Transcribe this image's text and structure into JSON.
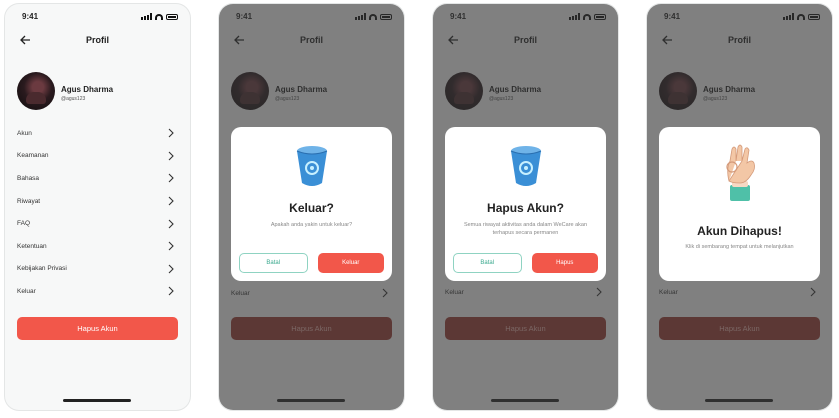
{
  "status": {
    "time": "9:41"
  },
  "header": {
    "title": "Profil"
  },
  "profile": {
    "name": "Agus Dharma",
    "username": "@agus123"
  },
  "menu": [
    {
      "label": "Akun"
    },
    {
      "label": "Keamanan"
    },
    {
      "label": "Bahasa"
    },
    {
      "label": "Riwayat"
    },
    {
      "label": "FAQ"
    },
    {
      "label": "Ketentuan"
    },
    {
      "label": "Kebijakan Privasi"
    },
    {
      "label": "Keluar"
    }
  ],
  "delete_button": "Hapus Akun",
  "logout_modal": {
    "title": "Keluar?",
    "text": "Apakah anda yakin untuk keluar?",
    "cancel": "Batal",
    "confirm": "Keluar"
  },
  "delete_modal": {
    "title": "Hapus Akun?",
    "text": "Semua riwayat aktivitas anda dalam WeCare akan terhapus secara permanen",
    "cancel": "Batal",
    "confirm": "Hapus"
  },
  "deleted_modal": {
    "title": "Akun Dihapus!",
    "text": "Klik di sembarang tempat untuk melanjutkan"
  },
  "colors": {
    "accent": "#f2574a",
    "teal": "#3aa98e",
    "overlay": "#373737"
  },
  "icons": {
    "back": "arrow-left-icon",
    "chevron": "chevron-right-icon",
    "trash": "trash-bin-icon",
    "ok_hand": "ok-hand-icon"
  }
}
